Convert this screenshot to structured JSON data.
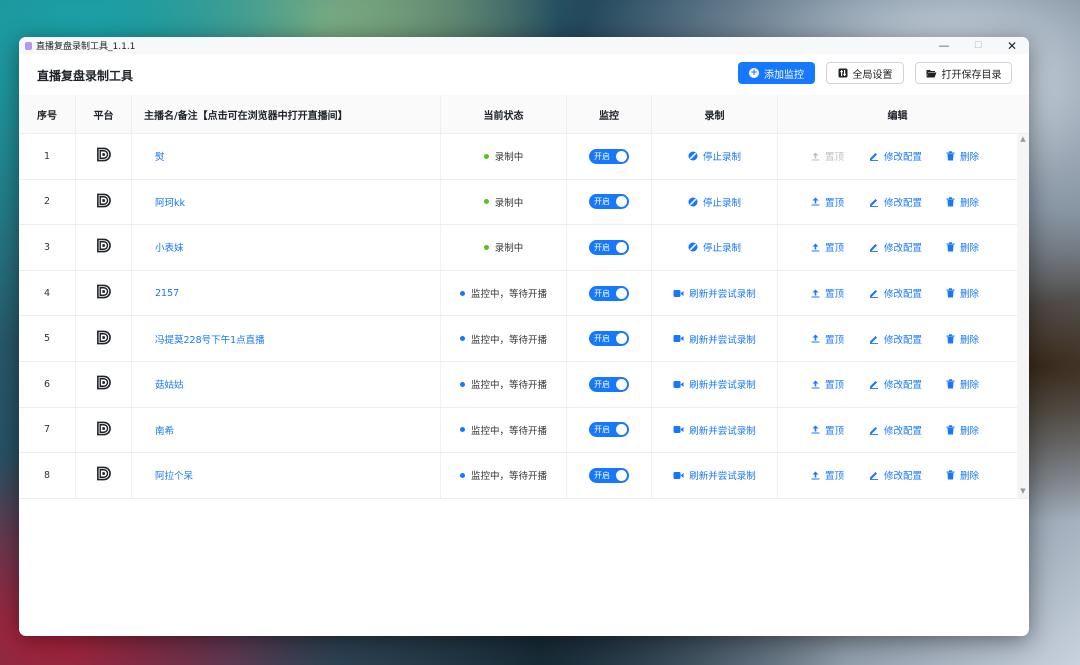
{
  "window": {
    "title": "直播复盘录制工具_1.1.1",
    "minimize": "—",
    "maximize": "☐",
    "close": "✕"
  },
  "header": {
    "app_title": "直播复盘录制工具",
    "add_button": "添加监控",
    "settings_button": "全局设置",
    "open_folder_button": "打开保存目录"
  },
  "table": {
    "columns": {
      "index": "序号",
      "platform": "平台",
      "name": "主播名/备注【点击可在浏览器中打开直播间】",
      "state": "当前状态",
      "monitor": "监控",
      "record": "录制",
      "edit": "编辑"
    },
    "rows": [
      {
        "index": "1",
        "platform": "douyin-logo",
        "name": "熨",
        "state": "录制中",
        "state_color": "#52c41a",
        "monitor": "开启",
        "record": "停止录制",
        "record_icon": "stop-icon",
        "top": "置顶",
        "top_disabled": true,
        "config": "修改配置",
        "delete": "删除"
      },
      {
        "index": "2",
        "platform": "douyin-logo",
        "name": "阿珂kk",
        "state": "录制中",
        "state_color": "#52c41a",
        "monitor": "开启",
        "record": "停止录制",
        "record_icon": "stop-icon",
        "top": "置顶",
        "top_disabled": false,
        "config": "修改配置",
        "delete": "删除"
      },
      {
        "index": "3",
        "platform": "douyin-logo",
        "name": "小表妹",
        "state": "录制中",
        "state_color": "#52c41a",
        "monitor": "开启",
        "record": "停止录制",
        "record_icon": "stop-icon",
        "top": "置顶",
        "top_disabled": false,
        "config": "修改配置",
        "delete": "删除"
      },
      {
        "index": "4",
        "platform": "douyin-logo",
        "name": "2157",
        "state": "监控中，等待开播",
        "state_color": "#1677ff",
        "monitor": "开启",
        "record": "刷新并尝试录制",
        "record_icon": "video-icon",
        "top": "置顶",
        "top_disabled": false,
        "config": "修改配置",
        "delete": "删除"
      },
      {
        "index": "5",
        "platform": "douyin-logo",
        "name": "冯提莫228号下午1点直播",
        "state": "监控中，等待开播",
        "state_color": "#1677ff",
        "monitor": "开启",
        "record": "刷新并尝试录制",
        "record_icon": "video-icon",
        "top": "置顶",
        "top_disabled": false,
        "config": "修改配置",
        "delete": "删除"
      },
      {
        "index": "6",
        "platform": "douyin-logo",
        "name": "菇姑姑",
        "state": "监控中，等待开播",
        "state_color": "#1677ff",
        "monitor": "开启",
        "record": "刷新并尝试录制",
        "record_icon": "video-icon",
        "top": "置顶",
        "top_disabled": false,
        "config": "修改配置",
        "delete": "删除"
      },
      {
        "index": "7",
        "platform": "douyin-logo",
        "name": "南希",
        "state": "监控中，等待开播",
        "state_color": "#1677ff",
        "monitor": "开启",
        "record": "刷新并尝试录制",
        "record_icon": "video-icon",
        "top": "置顶",
        "top_disabled": false,
        "config": "修改配置",
        "delete": "删除"
      },
      {
        "index": "8",
        "platform": "douyin-logo",
        "name": "阿拉个呆",
        "state": "监控中，等待开播",
        "state_color": "#1677ff",
        "monitor": "开启",
        "record": "刷新并尝试录制",
        "record_icon": "video-icon",
        "top": "置顶",
        "top_disabled": false,
        "config": "修改配置",
        "delete": "删除"
      }
    ]
  },
  "colors": {
    "accent": "#1677ff",
    "recording": "#52c41a",
    "disabled": "#bfbfbf"
  }
}
